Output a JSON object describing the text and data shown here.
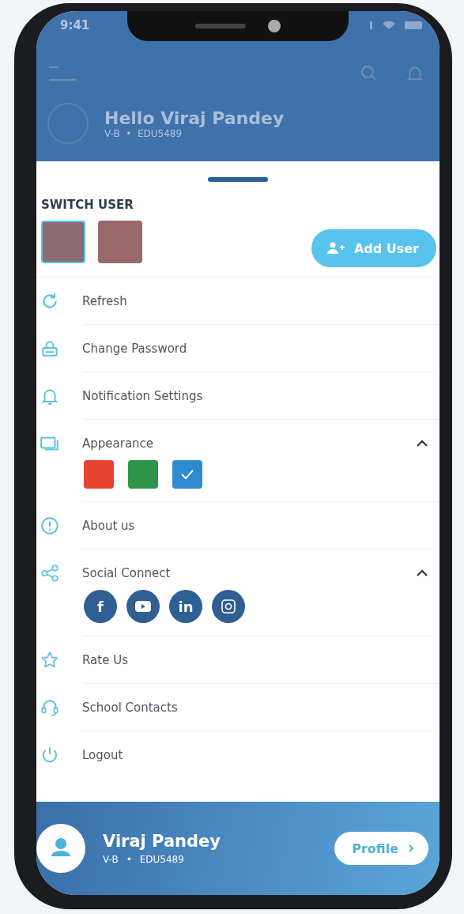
{
  "status_bar": {
    "time": "9:41"
  },
  "header": {
    "greeting": "Hello Viraj Pandey",
    "subtitle": "V-B  •  EDU5489"
  },
  "switch_user": {
    "title": "SWITCH USER",
    "users": [
      {
        "selected": true
      },
      {
        "selected": false
      }
    ],
    "add_button": "Add User"
  },
  "menu": [
    {
      "kind": "refresh",
      "label": "Refresh"
    },
    {
      "kind": "password",
      "label": "Change Password"
    },
    {
      "kind": "notification",
      "label": "Notification Settings"
    },
    {
      "kind": "appearance",
      "label": "Appearance",
      "expanded": true,
      "themes": [
        {
          "color": "#e8432f",
          "selected": false
        },
        {
          "color": "#2f9448",
          "selected": false
        },
        {
          "color": "#2f8bd0",
          "selected": true
        }
      ]
    },
    {
      "kind": "about",
      "label": "About us"
    },
    {
      "kind": "social",
      "label": "Social Connect",
      "expanded": true,
      "links": [
        {
          "kind": "facebook",
          "glyph": "f"
        },
        {
          "kind": "youtube"
        },
        {
          "kind": "linkedin",
          "glyph": "in"
        },
        {
          "kind": "instagram"
        }
      ]
    },
    {
      "kind": "rate",
      "label": "Rate Us"
    },
    {
      "kind": "contacts",
      "label": "School Contacts"
    },
    {
      "kind": "logout",
      "label": "Logout"
    }
  ],
  "profile_bar": {
    "name": "Viraj Pandey",
    "class": "V-B",
    "separator": "•",
    "id": "EDU5489",
    "button": "Profile"
  }
}
